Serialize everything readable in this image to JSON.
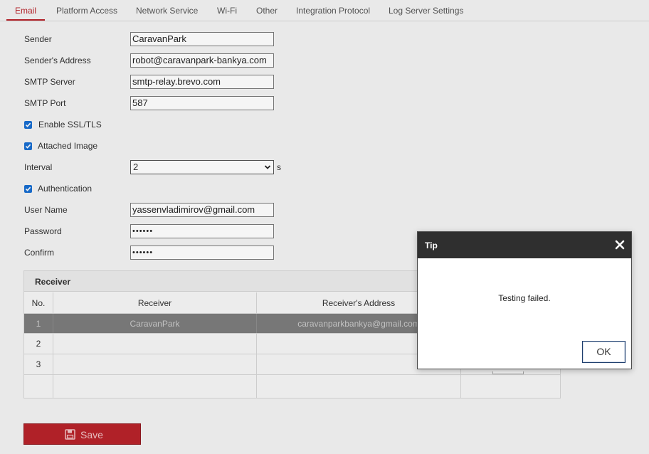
{
  "tabs": [
    {
      "label": "Email",
      "active": true
    },
    {
      "label": "Platform Access"
    },
    {
      "label": "Network Service"
    },
    {
      "label": "Wi-Fi"
    },
    {
      "label": "Other"
    },
    {
      "label": "Integration Protocol"
    },
    {
      "label": "Log Server Settings"
    }
  ],
  "form": {
    "sender_label": "Sender",
    "sender_value": "CaravanPark",
    "sender_address_label": "Sender's Address",
    "sender_address_value": "robot@caravanpark-bankya.com",
    "smtp_server_label": "SMTP Server",
    "smtp_server_value": "smtp-relay.brevo.com",
    "smtp_port_label": "SMTP Port",
    "smtp_port_value": "587",
    "ssl_label": "Enable SSL/TLS",
    "ssl_checked": true,
    "attached_image_label": "Attached Image",
    "attached_image_checked": true,
    "interval_label": "Interval",
    "interval_value": "2",
    "interval_unit": "s",
    "auth_label": "Authentication",
    "auth_checked": true,
    "username_label": "User Name",
    "username_value": "yassenvladimirov@gmail.com",
    "password_label": "Password",
    "password_value": "••••••",
    "confirm_label": "Confirm",
    "confirm_value": "••••••"
  },
  "receiver": {
    "title": "Receiver",
    "columns": [
      "No.",
      "Receiver",
      "Receiver's Address"
    ],
    "rows": [
      {
        "no": "1",
        "receiver": "CaravanPark",
        "address": "caravanparkbankya@gmail.com",
        "selected": true
      },
      {
        "no": "2",
        "receiver": "",
        "address": ""
      },
      {
        "no": "3",
        "receiver": "",
        "address": ""
      }
    ]
  },
  "save_label": "Save",
  "dialog": {
    "title": "Tip",
    "message": "Testing failed.",
    "ok_label": "OK"
  },
  "colors": {
    "accent": "#b8232a",
    "checkbox": "#1a6fd1",
    "dialog_header": "#2f2f2f"
  }
}
